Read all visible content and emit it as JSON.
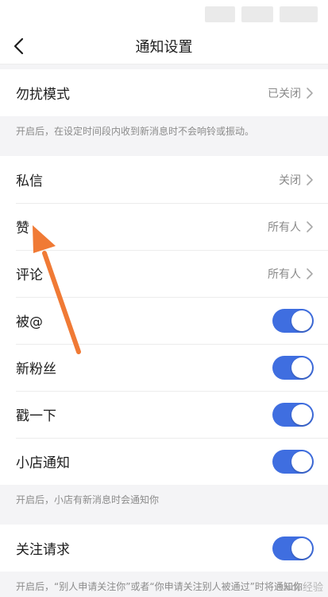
{
  "header": {
    "title": "通知设置"
  },
  "dnd": {
    "label": "勿扰模式",
    "value": "已关闭",
    "hint": "开启后，在设定时间段内收到新消息时不会响铃或振动。"
  },
  "messages": [
    {
      "label": "私信",
      "value": "关闭"
    },
    {
      "label": "赞",
      "value": "所有人"
    },
    {
      "label": "评论",
      "value": "所有人"
    }
  ],
  "toggles": [
    {
      "label": "被@",
      "on": true
    },
    {
      "label": "新粉丝",
      "on": true
    },
    {
      "label": "戳一下",
      "on": true
    },
    {
      "label": "小店通知",
      "on": true
    }
  ],
  "shop_hint": "开启后，小店有新消息时会通知你",
  "follow": {
    "label": "关注请求",
    "on": true,
    "hint": "开启后，“别人申请关注你”或者“你申请关注别人被通过”时将通知你"
  },
  "watermark": "Baidu经验",
  "colors": {
    "toggle_on": "#3f6ee0",
    "annotation_arrow": "#f07a35",
    "background": "#f4f4f6"
  }
}
